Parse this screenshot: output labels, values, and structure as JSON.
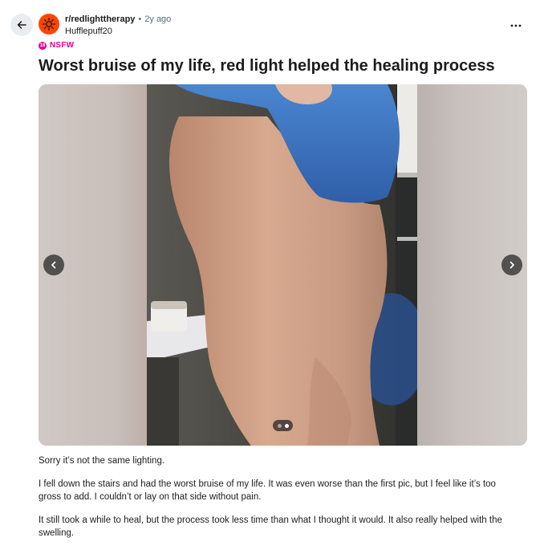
{
  "header": {
    "subreddit": "r/redlighttherapy",
    "separator": "•",
    "time_ago": "2y ago",
    "author": "Hufflepuff20"
  },
  "post": {
    "nsfw_label": "NSFW",
    "nsfw_icon_text": "18",
    "title": "Worst bruise of my life, red light helped the healing process",
    "gallery": {
      "current": 2,
      "total": 2
    },
    "body": [
      "Sorry it’s not the same lighting.",
      "I fell down the stairs and had the worst bruise of my life. It was even worse than the first pic, but I feel like it’s too gross to add. I couldn’t or lay on that side without pain.",
      "It still took a while to heal, but the process took less time than what I thought it would. It also really helped with the swelling."
    ]
  },
  "icons": {
    "back": "arrow-left-icon",
    "more": "more-horizontal-icon",
    "prev": "chevron-left-icon",
    "next": "chevron-right-icon",
    "subreddit": "subreddit-avatar-icon"
  },
  "colors": {
    "accent": "#ff4500",
    "nsfw": "#e00096",
    "meta_text": "#576f76",
    "back_bg": "#eaedef"
  }
}
